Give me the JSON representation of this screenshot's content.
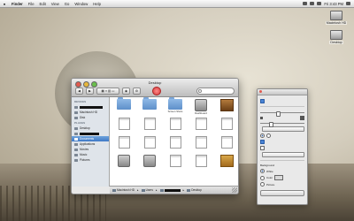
{
  "menubar": {
    "apple_icon": "apple-icon",
    "items": [
      "Finder",
      "File",
      "Edit",
      "View",
      "Go",
      "Window",
      "Help"
    ],
    "right_status": "Fri 3:43 PM"
  },
  "desktop": {
    "drives": [
      {
        "label": "Macintosh HD"
      },
      {
        "label": "Desktop"
      }
    ]
  },
  "finder": {
    "title": "Desktop",
    "search_placeholder": "",
    "sidebar": {
      "devices_header": "DEVICES",
      "items": [
        {
          "label": "",
          "redacted": true
        },
        {
          "label": "Macintosh HD"
        },
        {
          "label": "Disk"
        }
      ],
      "places_header": "PLACES",
      "places": [
        {
          "label": "Desktop",
          "selected": false
        },
        {
          "label": "",
          "redacted": true,
          "selected": false
        },
        {
          "label": "Documents",
          "selected": true
        },
        {
          "label": "Applications",
          "selected": false
        },
        {
          "label": "Movies",
          "selected": false
        },
        {
          "label": "Music",
          "selected": false
        },
        {
          "label": "Pictures",
          "selected": false
        }
      ]
    },
    "files": [
      {
        "label": "",
        "kind": "folder"
      },
      {
        "label": "",
        "kind": "folder"
      },
      {
        "label": "Screen Shots",
        "kind": "folder"
      },
      {
        "label": "Dashboard",
        "kind": "app"
      },
      {
        "label": "",
        "kind": "img"
      },
      {
        "label": "",
        "kind": "doc"
      },
      {
        "label": "",
        "kind": "doc"
      },
      {
        "label": "",
        "kind": "doc"
      },
      {
        "label": "",
        "kind": "doc"
      },
      {
        "label": "",
        "kind": "doc"
      },
      {
        "label": "",
        "kind": "doc"
      },
      {
        "label": "",
        "kind": "doc"
      },
      {
        "label": "",
        "kind": "doc"
      },
      {
        "label": "",
        "kind": "doc"
      },
      {
        "label": "",
        "kind": "doc"
      },
      {
        "label": "",
        "kind": "app"
      },
      {
        "label": "",
        "kind": "app"
      },
      {
        "label": "",
        "kind": "doc"
      },
      {
        "label": "",
        "kind": "doc"
      },
      {
        "label": "",
        "kind": "photo"
      }
    ],
    "pathbar": [
      "Macintosh HD",
      "Users",
      "",
      "Desktop"
    ]
  },
  "inspector": {
    "title": "",
    "options": [
      {
        "label": "",
        "checked": true
      }
    ],
    "size_label": "",
    "size_value": "",
    "label_position": "",
    "label_options": [
      {
        "label": "",
        "checked": true
      },
      {
        "label": "",
        "checked": false
      }
    ],
    "arrange_label": "",
    "arrange_value": "",
    "background_header": "Background",
    "background_options": [
      {
        "label": "White",
        "selected": true
      },
      {
        "label": "Color",
        "selected": false
      },
      {
        "label": "Picture",
        "selected": false
      }
    ],
    "button_label": ""
  },
  "accent": "#3f78c6"
}
